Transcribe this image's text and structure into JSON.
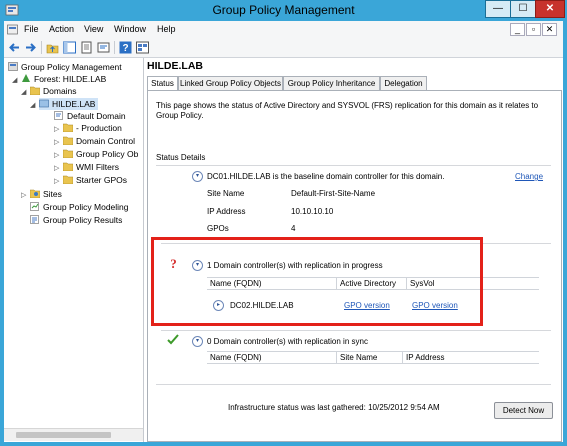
{
  "window": {
    "title": "Group Policy Management"
  },
  "window_controls": {
    "minimize": "—",
    "maximize": "☐",
    "close": "✕"
  },
  "menu": {
    "items": [
      "File",
      "Action",
      "View",
      "Window",
      "Help"
    ],
    "mdi": [
      "_",
      "▫",
      "✕"
    ]
  },
  "tree": {
    "items": [
      {
        "label": "Group Policy Management",
        "icon": "gpm-root-icon"
      },
      {
        "label": "Forest: HILDE.LAB",
        "icon": "forest-icon"
      },
      {
        "label": "Domains",
        "icon": "folder-icon"
      },
      {
        "label": "HILDE.LAB",
        "icon": "domain-icon"
      },
      {
        "label": "Default Domain",
        "icon": "gpo-link-icon"
      },
      {
        "label": "- Production",
        "icon": "folder-icon"
      },
      {
        "label": "Domain Control",
        "icon": "folder-icon"
      },
      {
        "label": "Group Policy Ob",
        "icon": "folder-icon"
      },
      {
        "label": "WMI Filters",
        "icon": "folder-icon"
      },
      {
        "label": "Starter GPOs",
        "icon": "folder-icon"
      },
      {
        "label": "Sites",
        "icon": "sites-icon"
      },
      {
        "label": "Group Policy Modeling",
        "icon": "modeling-icon"
      },
      {
        "label": "Group Policy Results",
        "icon": "results-icon"
      }
    ]
  },
  "pane": {
    "title": "HILDE.LAB",
    "tabs": [
      "Status",
      "Linked Group Policy Objects",
      "Group Policy Inheritance",
      "Delegation"
    ],
    "active_tab": "Status"
  },
  "status": {
    "description": "This page shows the status of Active Directory and SYSVOL (FRS) replication for this domain as it relates to Group Policy.",
    "section_label": "Status Details",
    "baseline": {
      "text": "DC01.HILDE.LAB is the baseline domain controller for this domain.",
      "change_link": "Change",
      "fields": [
        {
          "label": "Site Name",
          "value": "Default-First-Site-Name"
        },
        {
          "label": "IP Address",
          "value": "10.10.10.10"
        },
        {
          "label": "GPOs",
          "value": "4"
        }
      ]
    },
    "in_progress": {
      "text": "1 Domain controller(s) with replication in progress",
      "columns": [
        "Name (FQDN)",
        "Active Directory",
        "SysVol"
      ],
      "rows": [
        {
          "name": "DC02.HILDE.LAB",
          "ad": "GPO version",
          "sysvol": "GPO version"
        }
      ]
    },
    "in_sync": {
      "text": "0 Domain controller(s) with replication in sync",
      "columns": [
        "Name (FQDN)",
        "Site Name",
        "IP Address"
      ]
    },
    "footer": "Infrastructure status was last gathered: 10/25/2012 9:54 AM",
    "detect_button": "Detect Now"
  },
  "colors": {
    "title_bar": "#3aa6d8",
    "highlight": "#e32119",
    "link": "#1f57b8"
  }
}
